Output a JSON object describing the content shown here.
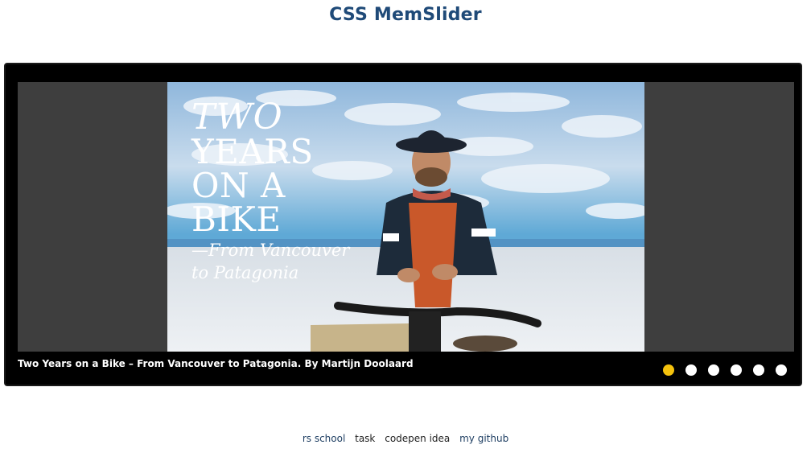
{
  "header": {
    "title": "CSS MemSlider"
  },
  "slide": {
    "overlay_title_line1": "TWO",
    "overlay_title_line2": "YEARS",
    "overlay_title_line3": "ON A",
    "overlay_title_line4": "BIKE",
    "overlay_subtitle_line1": "—From Vancouver",
    "overlay_subtitle_line2": "to Patagonia",
    "caption": "Two Years on a Bike – From Vancouver to Patagonia. By Martijn Doolaard"
  },
  "pagination": {
    "count": 6,
    "active_index": 0,
    "colors": {
      "active": "#f4c20d",
      "inactive": "#ffffff"
    }
  },
  "footer": {
    "links": [
      "rs school",
      "task",
      "codepen idea",
      "my github"
    ]
  }
}
